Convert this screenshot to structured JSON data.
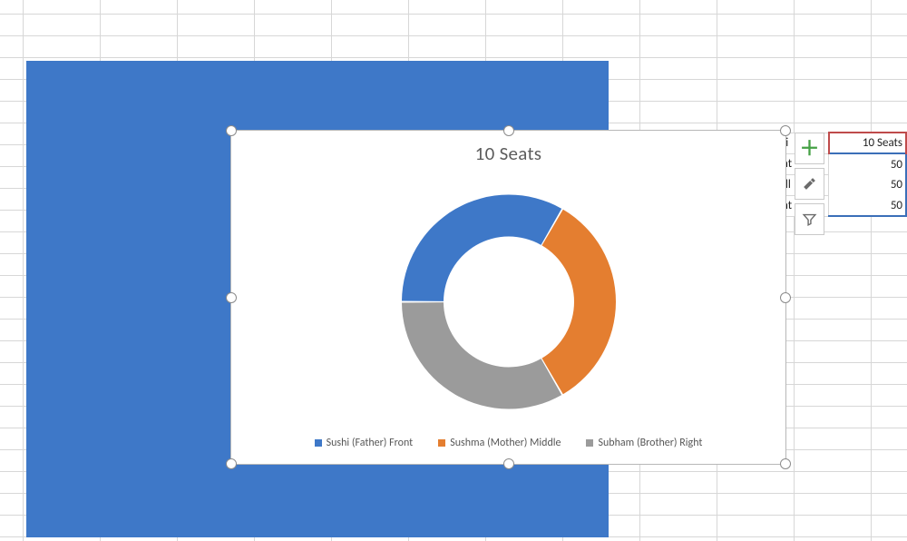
{
  "colors": {
    "series1": "#3e78c8",
    "series2": "#e47e30",
    "series3": "#9b9b9b",
    "blueShape": "#3e78c8"
  },
  "chart_data": {
    "type": "pie",
    "title": "10 Seats",
    "series": [
      {
        "name": "Sushi (Father) Front",
        "value": 50
      },
      {
        "name": "Sushma (Mother) Middle",
        "value": 50
      },
      {
        "name": "Subham (Brother) Right",
        "value": 50
      }
    ],
    "donut": true
  },
  "source_table": {
    "header_label": "10 Seats",
    "rows": [
      {
        "label": "nt",
        "value": 50
      },
      {
        "label": "dl",
        "value": 50
      },
      {
        "label": "nt",
        "value": 50
      }
    ],
    "label_col_prefix": "ti"
  },
  "chart_tools": {
    "add": "＋",
    "style": "✎",
    "filter": "▼"
  }
}
